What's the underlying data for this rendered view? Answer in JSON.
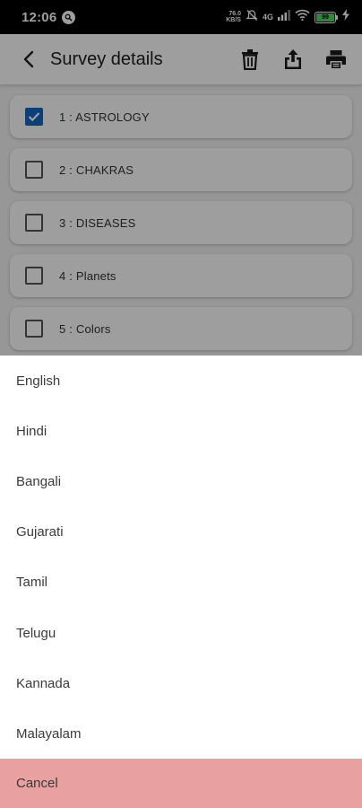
{
  "status_bar": {
    "time": "12:06",
    "net_speed_value": "76.0",
    "net_speed_unit": "KB/S",
    "network_type": "4G",
    "battery": "99"
  },
  "app_bar": {
    "title": "Survey details",
    "icons": [
      "back-arrow-icon",
      "trash-icon",
      "share-icon",
      "print-icon"
    ]
  },
  "surveys": [
    {
      "label": "1 : ASTROLOGY",
      "checked": true
    },
    {
      "label": "2 : CHAKRAS",
      "checked": false
    },
    {
      "label": "3 : DISEASES",
      "checked": false
    },
    {
      "label": "4 : Planets",
      "checked": false
    },
    {
      "label": "5 : Colors",
      "checked": false
    }
  ],
  "language_sheet": {
    "options": [
      "English",
      "Hindi",
      "Bangali",
      "Gujarati",
      "Tamil",
      "Telugu",
      "Kannada",
      "Malayalam"
    ],
    "cancel_label": "Cancel"
  },
  "colors": {
    "accent": "#1565c0",
    "cancel_background": "#e8a0a0"
  }
}
